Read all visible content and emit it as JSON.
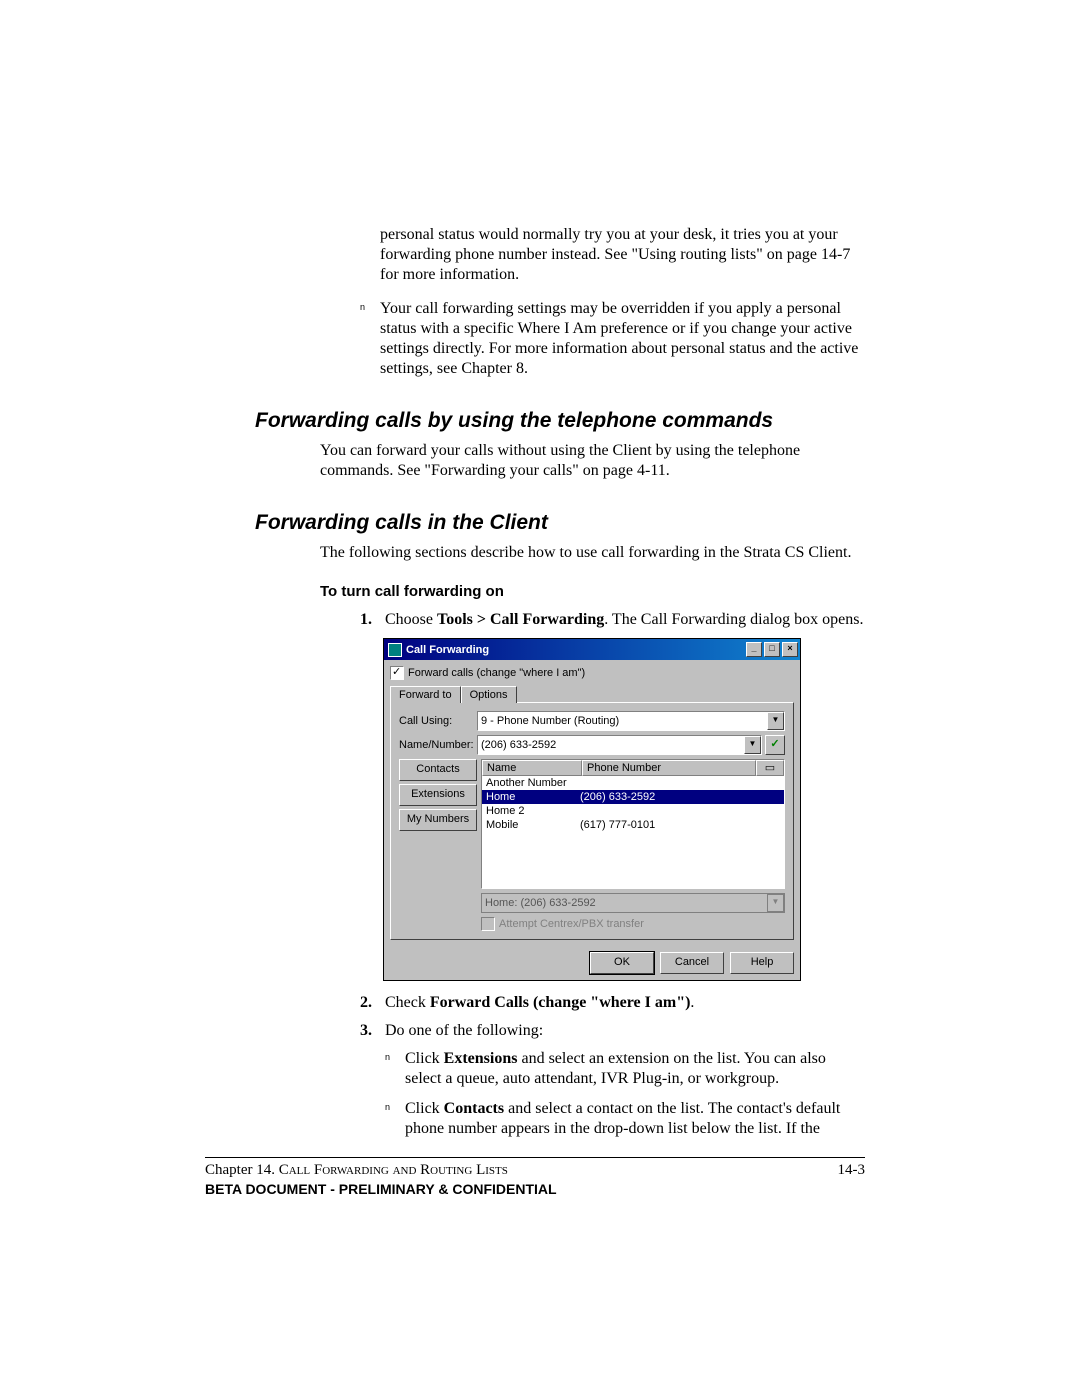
{
  "intro": {
    "continuation": "personal status would normally try you at your desk, it tries you at your forwarding phone number instead. See \"Using routing lists\" on page 14-7 for more information.",
    "bullet2": "Your call forwarding settings may be overridden if you apply a personal status with a specific Where I Am preference or if you change your active settings directly. For more information about personal status and the active settings, see Chapter 8."
  },
  "sec1": {
    "heading": "Forwarding calls by using the telephone commands",
    "body": "You can forward your calls without using the Client by using the telephone commands. See \"Forwarding your calls\" on page 4-11."
  },
  "sec2": {
    "heading": "Forwarding calls in the Client",
    "body": "The following sections describe how to use call forwarding in the Strata CS Client.",
    "sub": "To turn call forwarding on",
    "step1_a": "Choose ",
    "step1_b": "Tools > Call Forwarding",
    "step1_c": ". The Call Forwarding dialog box opens.",
    "step2_a": "Check ",
    "step2_b": "Forward Calls (change \"where I am\")",
    "step2_c": ".",
    "step3": "Do one of the following:",
    "step3_bullet1_a": "Click ",
    "step3_bullet1_b": "Extensions",
    "step3_bullet1_c": " and select an extension on the list. You can also select a queue, auto attendant, IVR Plug-in, or workgroup.",
    "step3_bullet2_a": "Click ",
    "step3_bullet2_b": "Contacts",
    "step3_bullet2_c": " and select a contact on the list. The contact's default phone number appears in the drop-down list below the list. If the"
  },
  "dialog": {
    "title": "Call Forwarding",
    "checkbox": "Forward calls (change \"where I am\")",
    "tab1": "Forward to",
    "tab2": "Options",
    "label_call_using": "Call Using:",
    "value_call_using": "9 - Phone Number (Routing)",
    "label_name_number": "Name/Number:",
    "value_name_number": "(206) 633-2592",
    "btn_contacts": "Contacts",
    "btn_extensions": "Extensions",
    "btn_my_numbers": "My Numbers",
    "col_name": "Name",
    "col_phone": "Phone Number",
    "rows": [
      {
        "name": "Another Number",
        "phone": ""
      },
      {
        "name": "Home",
        "phone": "(206) 633-2592"
      },
      {
        "name": "Home 2",
        "phone": ""
      },
      {
        "name": "Mobile",
        "phone": "(617) 777-0101"
      }
    ],
    "selected_index": 1,
    "below_combo": "Home:   (206) 633-2592",
    "disabled_check": "Attempt Centrex/PBX transfer",
    "btn_ok": "OK",
    "btn_cancel": "Cancel",
    "btn_help": "Help"
  },
  "footer": {
    "chapter_prefix": "Chapter 14. ",
    "chapter_title": "Call Forwarding and Routing Lists",
    "page": "14-3",
    "beta": "BETA DOCUMENT - PRELIMINARY & CONFIDENTIAL"
  }
}
